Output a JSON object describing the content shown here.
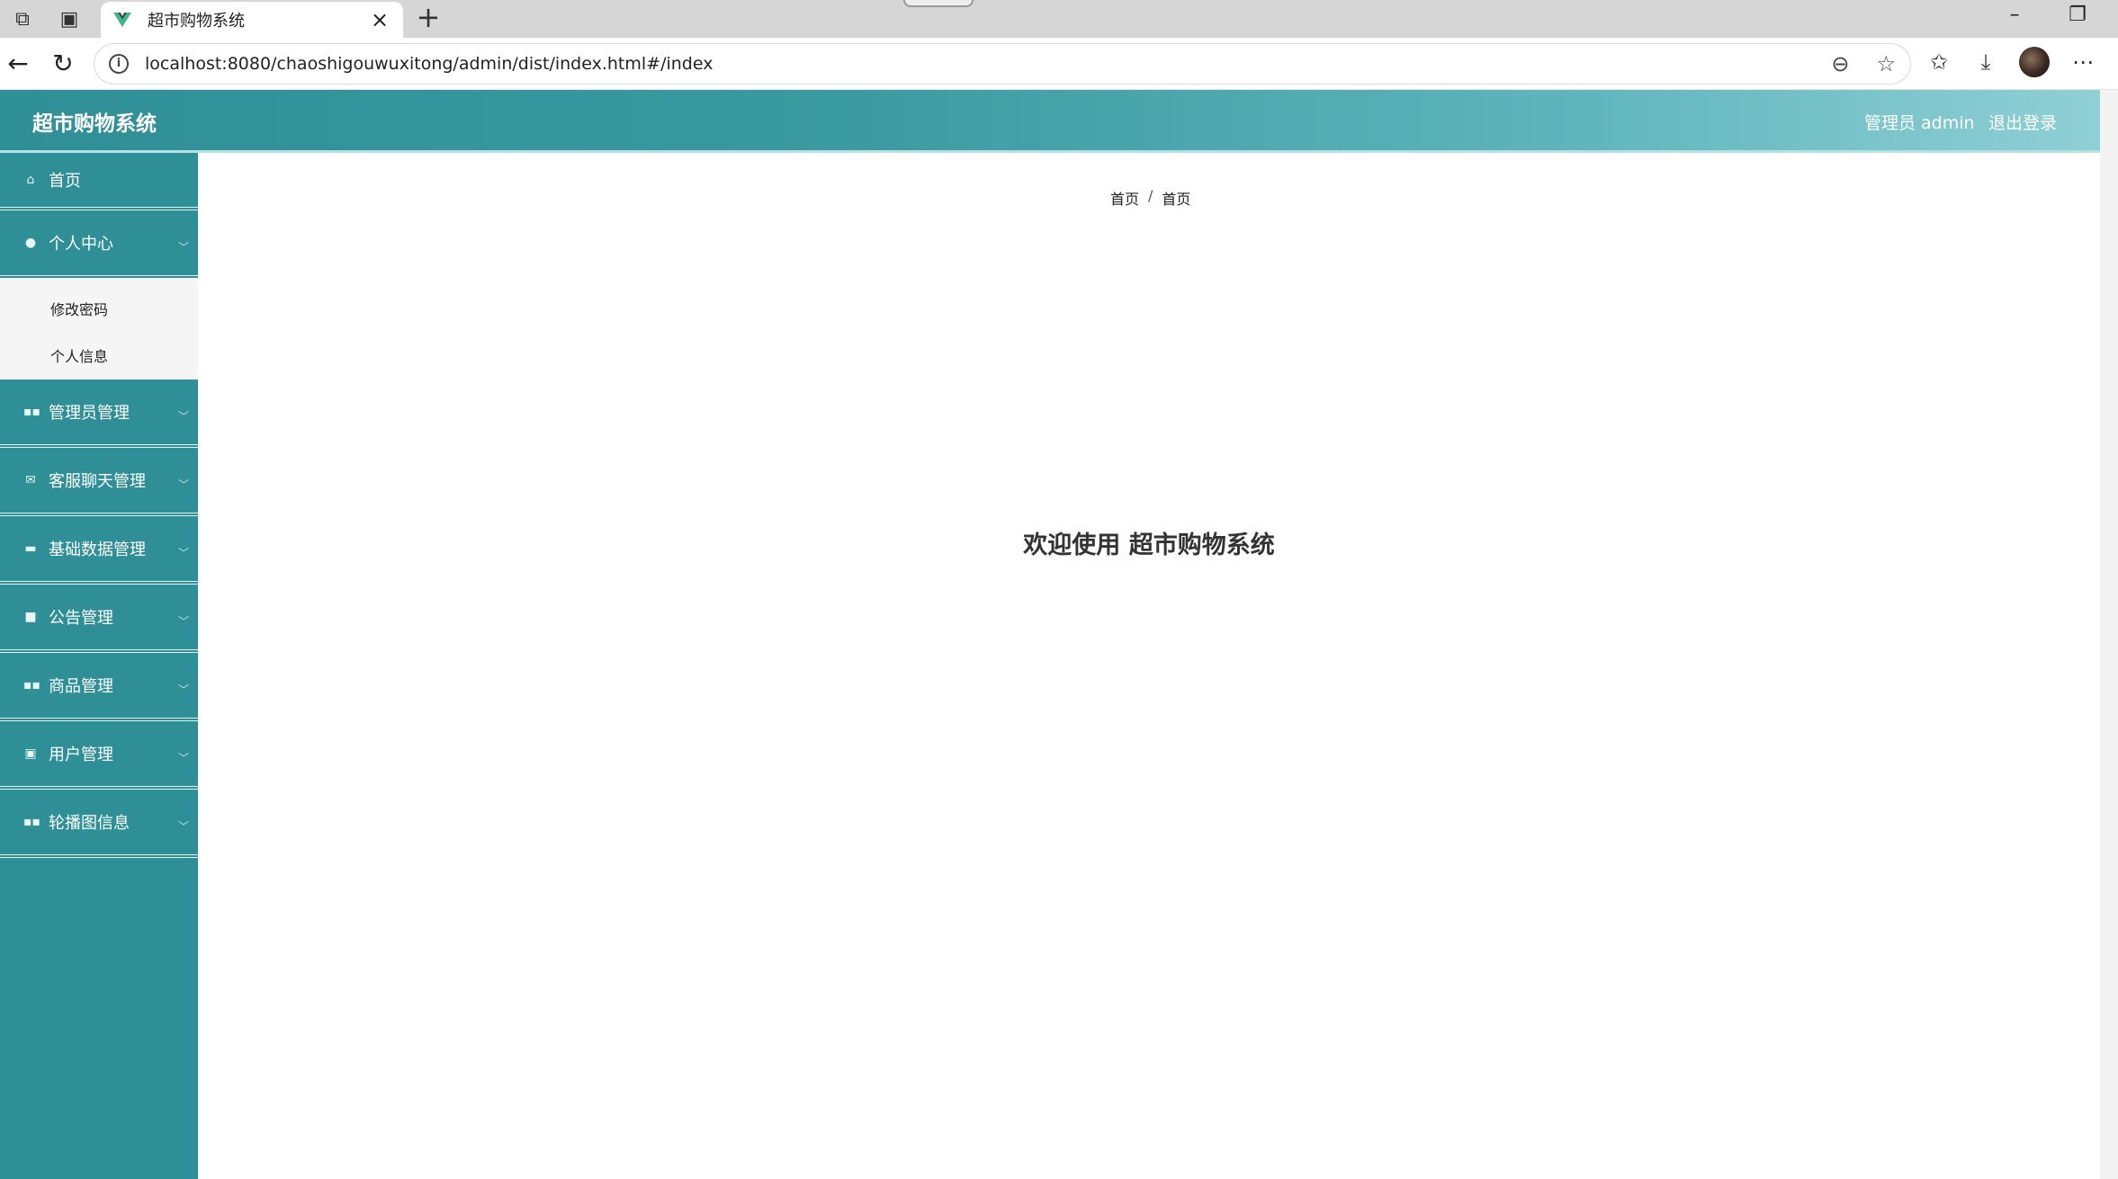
{
  "browser": {
    "tab_title": "超市购物系统",
    "url": "localhost:8080/chaoshigouwuxitong/admin/dist/index.html#/index"
  },
  "header": {
    "title": "超市购物系统",
    "user": "管理员 admin",
    "logout": "退出登录"
  },
  "sidebar": {
    "items": [
      {
        "label": "首页",
        "icon": "home-icon"
      },
      {
        "label": "个人中心",
        "icon": "user-icon"
      },
      {
        "label": "管理员管理",
        "icon": "grid-icon"
      },
      {
        "label": "客服聊天管理",
        "icon": "ticket-icon"
      },
      {
        "label": "基础数据管理",
        "icon": "briefcase-icon"
      },
      {
        "label": "公告管理",
        "icon": "message-icon"
      },
      {
        "label": "商品管理",
        "icon": "grid-icon"
      },
      {
        "label": "用户管理",
        "icon": "clipboard-icon"
      },
      {
        "label": "轮播图信息",
        "icon": "grid-icon"
      }
    ],
    "submenu_personal": [
      {
        "label": "修改密码"
      },
      {
        "label": "个人信息"
      }
    ]
  },
  "main": {
    "breadcrumb": [
      "首页",
      "首页"
    ],
    "breadcrumb_sep": "/",
    "welcome": "欢迎使用 超市购物系统"
  },
  "colors": {
    "sidebar_bg": "#2e9096",
    "header_start": "#2e8f96",
    "header_end": "#8fd0d6"
  }
}
